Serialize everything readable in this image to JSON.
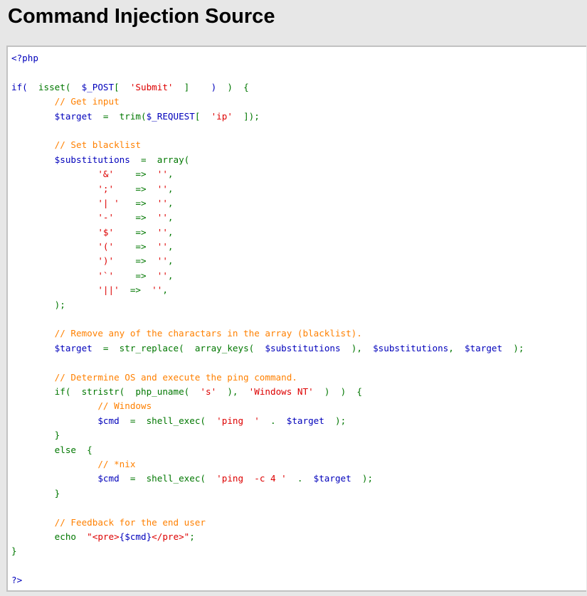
{
  "header": {
    "title": "Command Injection Source"
  },
  "colors": {
    "default": "#0000bb",
    "keyword": "#007700",
    "string": "#dd0000",
    "comment": "#ff8000",
    "background": "#e7e7e7",
    "code_background": "#ffffff",
    "border": "#c2c2c2"
  },
  "code_lines": [
    [
      [
        "default",
        "<?php"
      ]
    ],
    [],
    [
      [
        "default",
        "if( "
      ],
      [
        "keyword",
        " isset( "
      ],
      [
        "default",
        " $_POST"
      ],
      [
        "keyword",
        "[ "
      ],
      [
        "string",
        " 'Submit' "
      ],
      [
        "keyword",
        " ]   "
      ],
      [
        "default",
        " ) "
      ],
      [
        "keyword",
        " ) "
      ],
      [
        "keyword",
        " {"
      ]
    ],
    [
      [
        "keyword",
        "        "
      ],
      [
        "comment",
        "// Get input"
      ]
    ],
    [
      [
        "keyword",
        "        "
      ],
      [
        "default",
        "$target "
      ],
      [
        "keyword",
        " = "
      ],
      [
        "keyword",
        " trim("
      ],
      [
        "default",
        "$_REQUEST"
      ],
      [
        "keyword",
        "[ "
      ],
      [
        "string",
        " 'ip' "
      ],
      [
        "keyword",
        " ]);"
      ]
    ],
    [],
    [
      [
        "keyword",
        "        "
      ],
      [
        "comment",
        "// Set blacklist"
      ]
    ],
    [
      [
        "keyword",
        "        "
      ],
      [
        "default",
        "$substitutions "
      ],
      [
        "keyword",
        " = "
      ],
      [
        "keyword",
        " array("
      ]
    ],
    [
      [
        "keyword",
        "                "
      ],
      [
        "string",
        "'&' "
      ],
      [
        "keyword",
        "   => "
      ],
      [
        "string",
        " ''"
      ],
      [
        "keyword",
        ","
      ]
    ],
    [
      [
        "keyword",
        "                "
      ],
      [
        "string",
        "';' "
      ],
      [
        "keyword",
        "   => "
      ],
      [
        "string",
        " ''"
      ],
      [
        "keyword",
        ","
      ]
    ],
    [
      [
        "keyword",
        "                "
      ],
      [
        "string",
        "'| ' "
      ],
      [
        "keyword",
        "  => "
      ],
      [
        "string",
        " ''"
      ],
      [
        "keyword",
        ","
      ]
    ],
    [
      [
        "keyword",
        "                "
      ],
      [
        "string",
        "'-' "
      ],
      [
        "keyword",
        "   => "
      ],
      [
        "string",
        " ''"
      ],
      [
        "keyword",
        ","
      ]
    ],
    [
      [
        "keyword",
        "                "
      ],
      [
        "string",
        "'$' "
      ],
      [
        "keyword",
        "   => "
      ],
      [
        "string",
        " ''"
      ],
      [
        "keyword",
        ","
      ]
    ],
    [
      [
        "keyword",
        "                "
      ],
      [
        "string",
        "'(' "
      ],
      [
        "keyword",
        "   => "
      ],
      [
        "string",
        " ''"
      ],
      [
        "keyword",
        ","
      ]
    ],
    [
      [
        "keyword",
        "                "
      ],
      [
        "string",
        "')' "
      ],
      [
        "keyword",
        "   => "
      ],
      [
        "string",
        " ''"
      ],
      [
        "keyword",
        ","
      ]
    ],
    [
      [
        "keyword",
        "                "
      ],
      [
        "string",
        "'`' "
      ],
      [
        "keyword",
        "   => "
      ],
      [
        "string",
        " ''"
      ],
      [
        "keyword",
        ","
      ]
    ],
    [
      [
        "keyword",
        "                "
      ],
      [
        "string",
        "'||' "
      ],
      [
        "keyword",
        " => "
      ],
      [
        "string",
        " ''"
      ],
      [
        "keyword",
        ","
      ]
    ],
    [
      [
        "keyword",
        "        );"
      ]
    ],
    [],
    [
      [
        "keyword",
        "        "
      ],
      [
        "comment",
        "// Remove any of the charactars in the array (blacklist)."
      ]
    ],
    [
      [
        "keyword",
        "        "
      ],
      [
        "default",
        "$target "
      ],
      [
        "keyword",
        " = "
      ],
      [
        "keyword",
        " str_replace( "
      ],
      [
        "keyword",
        " array_keys( "
      ],
      [
        "default",
        " $substitutions "
      ],
      [
        "keyword",
        " ), "
      ],
      [
        "default",
        " $substitutions"
      ],
      [
        "keyword",
        ", "
      ],
      [
        "default",
        " $target "
      ],
      [
        "keyword",
        " );"
      ]
    ],
    [],
    [
      [
        "keyword",
        "        "
      ],
      [
        "comment",
        "// Determine OS and execute the ping command."
      ]
    ],
    [
      [
        "keyword",
        "        if( "
      ],
      [
        "keyword",
        " stristr( "
      ],
      [
        "keyword",
        " php_uname( "
      ],
      [
        "string",
        " 's' "
      ],
      [
        "keyword",
        " ), "
      ],
      [
        "string",
        " 'Windows NT' "
      ],
      [
        "keyword",
        " ) "
      ],
      [
        "keyword",
        " ) "
      ],
      [
        "keyword",
        " {"
      ]
    ],
    [
      [
        "keyword",
        "                "
      ],
      [
        "comment",
        "// Windows"
      ]
    ],
    [
      [
        "keyword",
        "                "
      ],
      [
        "default",
        "$cmd "
      ],
      [
        "keyword",
        " = "
      ],
      [
        "keyword",
        " shell_exec( "
      ],
      [
        "string",
        " 'ping  ' "
      ],
      [
        "keyword",
        " . "
      ],
      [
        "default",
        " $target "
      ],
      [
        "keyword",
        " );"
      ]
    ],
    [
      [
        "keyword",
        "        }"
      ]
    ],
    [
      [
        "keyword",
        "        else "
      ],
      [
        "keyword",
        " {"
      ]
    ],
    [
      [
        "keyword",
        "                "
      ],
      [
        "comment",
        "// *nix"
      ]
    ],
    [
      [
        "keyword",
        "                "
      ],
      [
        "default",
        "$cmd "
      ],
      [
        "keyword",
        " = "
      ],
      [
        "keyword",
        " shell_exec( "
      ],
      [
        "string",
        " 'ping  -c 4 ' "
      ],
      [
        "keyword",
        " . "
      ],
      [
        "default",
        " $target "
      ],
      [
        "keyword",
        " );"
      ]
    ],
    [
      [
        "keyword",
        "        }"
      ]
    ],
    [],
    [
      [
        "keyword",
        "        "
      ],
      [
        "comment",
        "// Feedback for the end user"
      ]
    ],
    [
      [
        "keyword",
        "        echo "
      ],
      [
        "string",
        " \"<pre>"
      ],
      [
        "default",
        "{$cmd}"
      ],
      [
        "string",
        "</pre>\""
      ],
      [
        "keyword",
        ";"
      ]
    ],
    [
      [
        "keyword",
        "}"
      ]
    ],
    [],
    [
      [
        "default",
        "?>"
      ]
    ]
  ]
}
